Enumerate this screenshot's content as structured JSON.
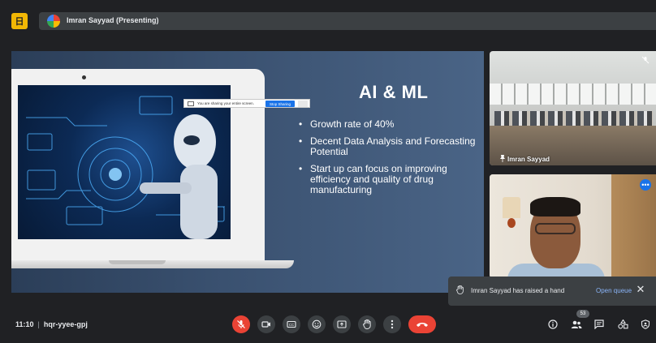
{
  "topbar": {
    "app_badge": "日",
    "presenter_label": "Imran Sayyad (Presenting)"
  },
  "slide": {
    "title": "AI & ML",
    "bullets": [
      "Growth rate of 40%",
      "Decent Data Analysis and Forecasting Potential",
      "Start up can focus on improving efficiency and quality of drug manufacturing"
    ],
    "share_bar": {
      "text": "You are sharing your entire screen.",
      "button": "Stop Sharing",
      "hide": "Hide"
    }
  },
  "tiles": {
    "room_label": "Imran Sayyad"
  },
  "toast": {
    "text": "Imran Sayyad has raised a hand",
    "link": "Open queue"
  },
  "bottombar": {
    "time": "11:10",
    "meeting_code": "hqr-yyee-gpj",
    "participants_count": "53"
  },
  "icons": {
    "mic": "mic-off-icon",
    "camera": "videocam-icon",
    "captions": "closed-caption-icon",
    "emoji": "emoji-icon",
    "present": "present-screen-icon",
    "hand": "raise-hand-icon",
    "more": "more-vert-icon",
    "end": "call-end-icon",
    "info": "info-icon",
    "people": "people-icon",
    "chat": "chat-icon",
    "activities": "activities-icon",
    "host": "host-controls-icon"
  },
  "colors": {
    "background": "#202124",
    "surface": "#3c4043",
    "accent": "#1a73e8",
    "danger": "#ea4335",
    "link": "#8ab4f8",
    "slide": "#3a5170"
  }
}
